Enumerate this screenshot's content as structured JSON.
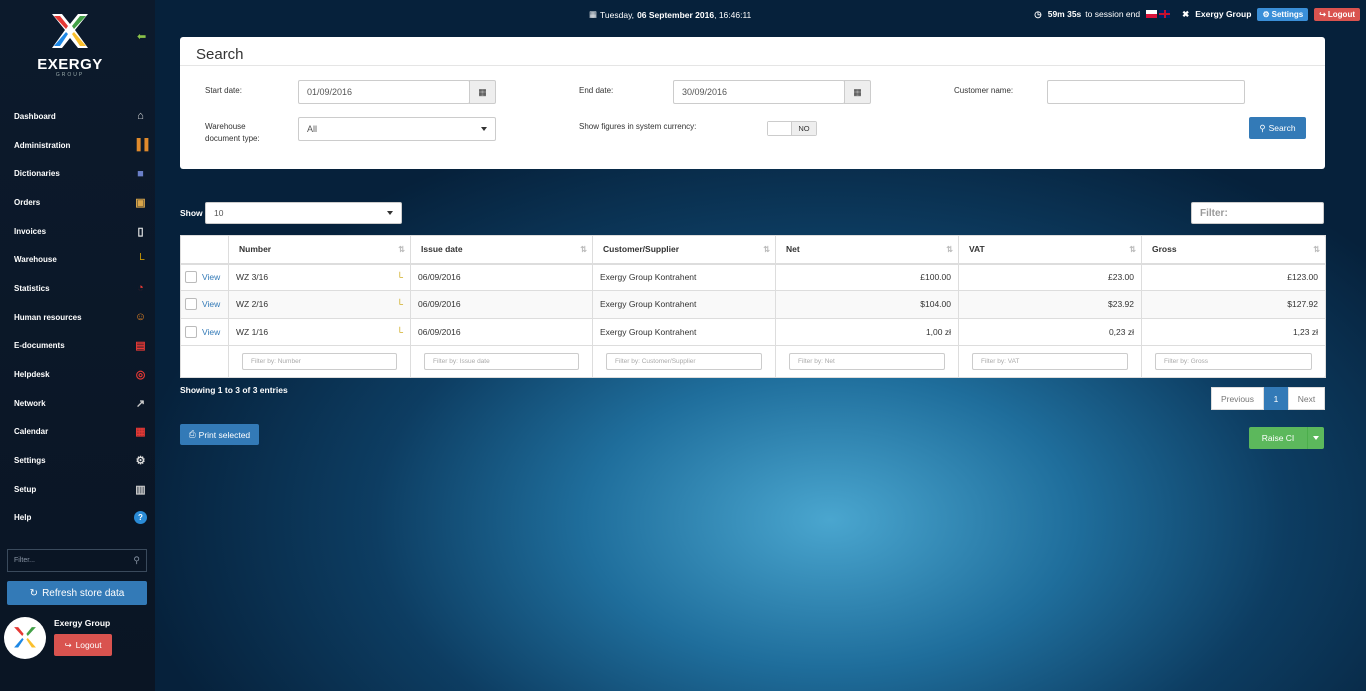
{
  "topbar": {
    "date_prefix": "Tuesday,",
    "date_bold": "06 September 2016",
    "time": ", 16:46:11",
    "session": "59m 35s",
    "session_suffix": "to session end",
    "company": "Exergy Group",
    "settings_label": "Settings",
    "logout_label": "Logout"
  },
  "sidebar": {
    "brand": "EXERGY",
    "brand_sub": "GROUP",
    "items": [
      {
        "label": "Dashboard",
        "icon": "home-icon"
      },
      {
        "label": "Administration",
        "icon": "books-icon"
      },
      {
        "label": "Dictionaries",
        "icon": "book-icon"
      },
      {
        "label": "Orders",
        "icon": "box-icon"
      },
      {
        "label": "Invoices",
        "icon": "document-icon"
      },
      {
        "label": "Warehouse",
        "icon": "forklift-icon"
      },
      {
        "label": "Statistics",
        "icon": "pie-chart-icon"
      },
      {
        "label": "Human resources",
        "icon": "person-icon"
      },
      {
        "label": "E-documents",
        "icon": "pdf-icon"
      },
      {
        "label": "Helpdesk",
        "icon": "lifebuoy-icon"
      },
      {
        "label": "Network",
        "icon": "network-icon"
      },
      {
        "label": "Calendar",
        "icon": "calendar-icon"
      },
      {
        "label": "Settings",
        "icon": "gear-icon"
      },
      {
        "label": "Setup",
        "icon": "setup-icon"
      },
      {
        "label": "Help",
        "icon": "help-icon"
      }
    ],
    "filter_placeholder": "Filter...",
    "refresh_label": "Refresh store data",
    "user_name": "Exergy Group",
    "logout_label": "Logout"
  },
  "search": {
    "title": "Search",
    "start_date_label": "Start date:",
    "start_date_value": "01/09/2016",
    "end_date_label": "End date:",
    "end_date_value": "30/09/2016",
    "customer_label": "Customer name:",
    "customer_value": "",
    "warehouse_label_1": "Warehouse",
    "warehouse_label_2": "document type:",
    "warehouse_value": "All",
    "currency_label": "Show figures in system currency:",
    "toggle_value": "NO",
    "search_button": "Search"
  },
  "list": {
    "show_label": "Show",
    "show_value": "10",
    "filter_label": "Filter:",
    "columns": [
      "Number",
      "Issue date",
      "Customer/Supplier",
      "Net",
      "VAT",
      "Gross"
    ],
    "rows": [
      {
        "view": "View",
        "number": "WZ 3/16",
        "date": "06/09/2016",
        "customer": "Exergy Group Kontrahent",
        "net": "£100.00",
        "vat": "£23.00",
        "gross": "£123.00"
      },
      {
        "view": "View",
        "number": "WZ 2/16",
        "date": "06/09/2016",
        "customer": "Exergy Group Kontrahent",
        "net": "$104.00",
        "vat": "$23.92",
        "gross": "$127.92"
      },
      {
        "view": "View",
        "number": "WZ 1/16",
        "date": "06/09/2016",
        "customer": "Exergy Group Kontrahent",
        "net": "1,00 zł",
        "vat": "0,23 zł",
        "gross": "1,23 zł"
      }
    ],
    "filters": [
      "Filter by: Number",
      "Filter by: Issue date",
      "Filter by: Customer/Supplier",
      "Filter by: Net",
      "Filter by: VAT",
      "Filter by: Gross"
    ],
    "entries": "Showing 1 to 3 of 3 entries",
    "prev": "Previous",
    "page": "1",
    "next": "Next",
    "print_label": "Print selected",
    "raise_label": "Raise CI"
  },
  "colors": {
    "primary": "#337ab7",
    "danger": "#d9534f",
    "success": "#5cb85c"
  }
}
